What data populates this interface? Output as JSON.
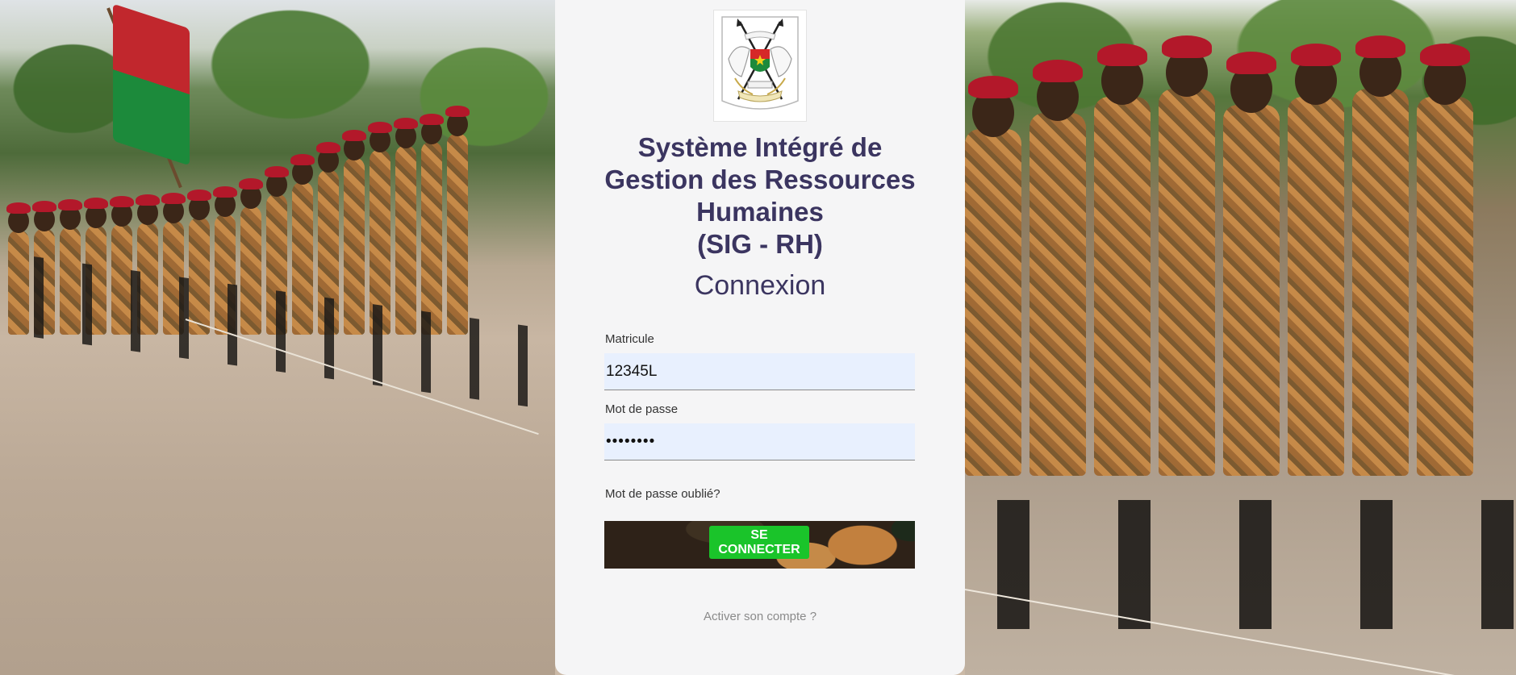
{
  "title_lines": [
    "Système Intégré de",
    "Gestion des Ressources",
    "Humaines",
    "(SIG - RH)"
  ],
  "subtitle": "Connexion",
  "form": {
    "matricule_label": "Matricule",
    "matricule_value": "12345L",
    "password_label": "Mot de passe",
    "password_value": "••••••••",
    "forgot_link": "Mot de passe oublié?",
    "submit_label": "SE CONNECTER",
    "activate_link": "Activer son compte ?"
  },
  "icons": {
    "emblem": "burkina-faso-coat-of-arms"
  },
  "colors": {
    "title": "#3b3560",
    "button": "#1ac42a",
    "input_bg": "#e8f0fe",
    "card_bg": "#f5f5f6"
  }
}
